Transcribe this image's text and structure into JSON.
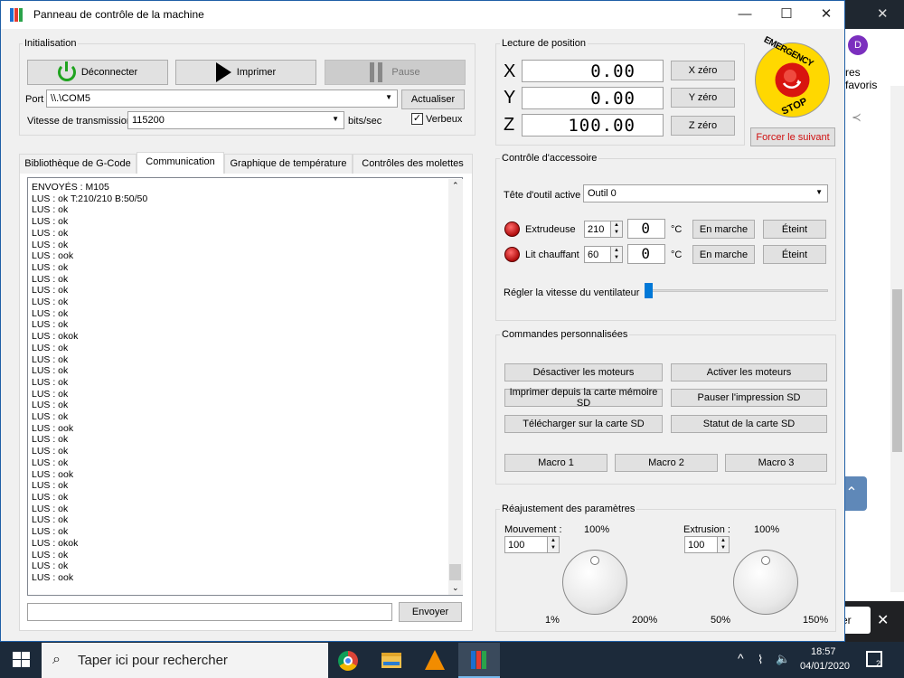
{
  "window": {
    "title": "Panneau de contrôle de la machine"
  },
  "init": {
    "label": "Initialisation",
    "disconnect": "Déconnecter",
    "print": "Imprimer",
    "pause": "Pause",
    "port_label": "Port",
    "port_value": "\\\\.\\COM5",
    "refresh": "Actualiser",
    "baud_label": "Vitesse de transmission",
    "baud_value": "115200",
    "baud_unit": "bits/sec",
    "verbose": "Verbeux"
  },
  "tabs": [
    "Bibliothèque de G-Code",
    "Communication",
    "Graphique de température",
    "Contrôles des molettes"
  ],
  "log": [
    "ENVOYÉS : M105",
    "LUS : ok T:210/210 B:50/50",
    "LUS : ok",
    "LUS : ok",
    "LUS : ok",
    "LUS : ok",
    "LUS : ook",
    "LUS : ok",
    "LUS : ok",
    "LUS : ok",
    "LUS : ok",
    "LUS : ok",
    "LUS : ok",
    "LUS : okok",
    "LUS : ok",
    "LUS : ok",
    "LUS : ok",
    "LUS : ok",
    "LUS : ok",
    "LUS : ok",
    "LUS : ok",
    "LUS : ook",
    "LUS : ok",
    "LUS : ok",
    "LUS : ok",
    "LUS : ook",
    "LUS : ok",
    "LUS : ok",
    "LUS : ok",
    "LUS : ok",
    "LUS : ok",
    "LUS : okok",
    "LUS : ok",
    "LUS : ok",
    "LUS : ook"
  ],
  "send": "Envoyer",
  "position": {
    "label": "Lecture de position",
    "x": "0.00",
    "y": "0.00",
    "z": "100.00",
    "x_zero": "X zéro",
    "y_zero": "Y zéro",
    "z_zero": "Z zéro",
    "force": "Forcer le suivant",
    "estop_top": "EMERGENCY",
    "estop_bottom": "STOP"
  },
  "accessory": {
    "label": "Contrôle d'accessoire",
    "tool_label": "Tête d'outil active",
    "tool_value": "Outil 0",
    "extruder": "Extrudeuse",
    "extruder_temp": "210",
    "bed": "Lit chauffant",
    "bed_temp": "60",
    "unit": "°C",
    "on": "En marche",
    "off": "Éteint",
    "fan": "Régler la vitesse du ventilateur"
  },
  "custom": {
    "label": "Commandes personnalisées",
    "disable_motors": "Désactiver les moteurs",
    "enable_motors": "Activer les moteurs",
    "print_sd": "Imprimer depuis la carte mémoire SD",
    "pause_sd": "Pauser l'impression SD",
    "upload_sd": "Télécharger sur la carte SD",
    "sd_status": "Statut de la carte SD",
    "macro1": "Macro 1",
    "macro2": "Macro 2",
    "macro3": "Macro 3"
  },
  "adjust": {
    "label": "Réajustement des paramètres",
    "move_label": "Mouvement :",
    "move_pct": "100%",
    "move_value": "100",
    "move_min": "1%",
    "move_max": "200%",
    "ext_label": "Extrusion :",
    "ext_pct": "100%",
    "ext_value": "100",
    "ext_min": "50%",
    "ext_max": "150%"
  },
  "browser": {
    "avatar": "D",
    "favorites": "res favoris",
    "partial_btn": "er"
  },
  "taskbar": {
    "search": "Taper ici pour rechercher",
    "time": "18:57",
    "date": "04/01/2020",
    "notif": "2"
  }
}
